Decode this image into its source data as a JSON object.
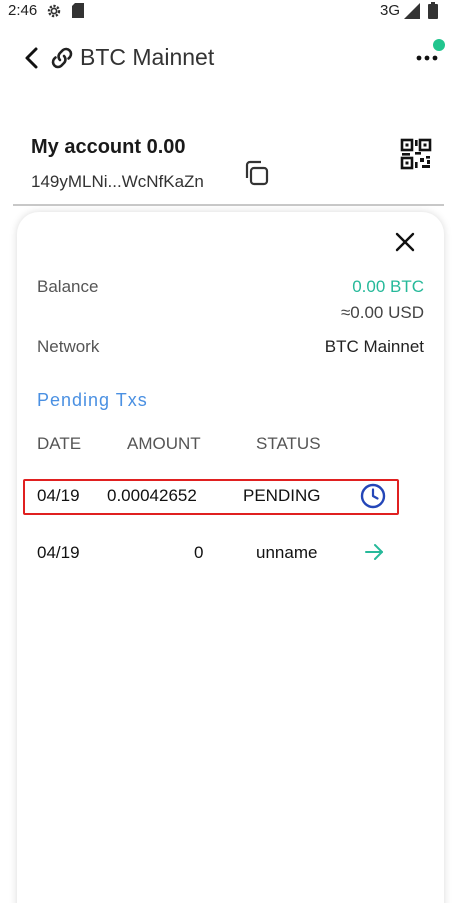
{
  "status_bar": {
    "time": "2:46",
    "network": "3G",
    "icons": [
      "gear-icon",
      "sd-card-icon",
      "signal-icon",
      "battery-icon"
    ]
  },
  "header": {
    "title": "BTC Mainnet",
    "icons": [
      "back-icon",
      "link-icon",
      "more-icon"
    ],
    "notification_color": "#21c58e"
  },
  "account": {
    "name": "My account 0.00",
    "address": "149yMLNi...WcNfKaZn"
  },
  "details": {
    "balance_label": "Balance",
    "balance_btc": "0.00 BTC",
    "balance_usd": "≈0.00 USD",
    "network_label": "Network",
    "network_value": "BTC Mainnet"
  },
  "pending": {
    "title": "Pending Txs",
    "columns": [
      "DATE",
      "AMOUNT",
      "STATUS"
    ],
    "rows": [
      {
        "date": "04/19",
        "amount": "0.00042652",
        "status": "PENDING",
        "icon": "clock-icon"
      },
      {
        "date": "04/19",
        "amount": "0",
        "status": "unname",
        "icon": "arrow-right-icon"
      }
    ]
  },
  "colors": {
    "accent_green": "#26b99a",
    "section_blue": "#4a90e2",
    "highlight_red": "#e02020",
    "clock_blue": "#2446b8"
  }
}
